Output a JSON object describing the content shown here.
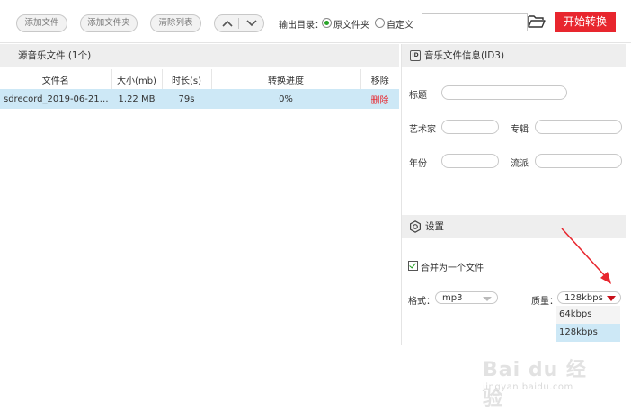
{
  "toolbar": {
    "add_file": "添加文件",
    "add_folder": "添加文件夹",
    "clear_list": "清除列表",
    "output_dir_label": "输出目录：",
    "option_original": "原文件夹",
    "option_custom": "自定义",
    "path_value": "",
    "start_button": "开始转换"
  },
  "file_list": {
    "header": "源音乐文件 (1个)",
    "columns": [
      "文件名",
      "大小(mb)",
      "时长(s)",
      "转换进度",
      "移除"
    ],
    "rows": [
      {
        "name": "sdrecord_2019-06-21-1...",
        "size": "1.22 MB",
        "duration": "79s",
        "progress": "0%",
        "remove": "删除"
      }
    ]
  },
  "id3": {
    "header": "音乐文件信息(ID3)",
    "badge": "ID",
    "title_label": "标题",
    "artist_label": "艺术家",
    "album_label": "专辑",
    "year_label": "年份",
    "genre_label": "流派"
  },
  "settings": {
    "header": "设置",
    "merge_label": "合并为一个文件",
    "merge_checked": true,
    "format_label": "格式：",
    "format_value": "mp3",
    "quality_label": "质量：",
    "quality_value": "128kbps",
    "quality_options": [
      "64kbps",
      "128kbps"
    ]
  },
  "watermark": {
    "main": "Bai du 经验",
    "sub": "jingyan.baidu.com"
  },
  "colors": {
    "accent_red": "#e8262e",
    "selection_blue": "#cde8f6",
    "radio_green": "#2aa52a"
  }
}
